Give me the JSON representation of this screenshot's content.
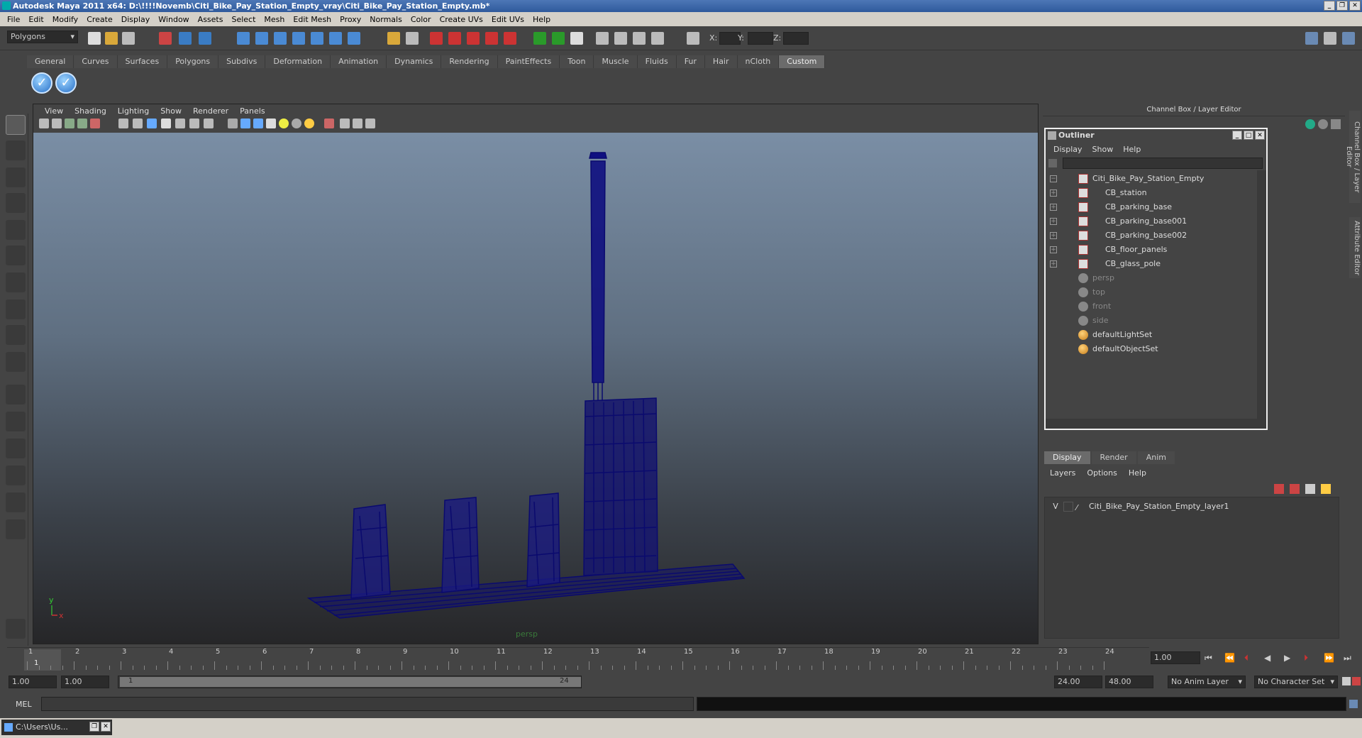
{
  "window": {
    "title": "Autodesk Maya 2011 x64: D:\\!!!!Novemb\\Citi_Bike_Pay_Station_Empty_vray\\Citi_Bike_Pay_Station_Empty.mb*"
  },
  "menubar": [
    "File",
    "Edit",
    "Modify",
    "Create",
    "Display",
    "Window",
    "Assets",
    "Select",
    "Mesh",
    "Edit Mesh",
    "Proxy",
    "Normals",
    "Color",
    "Create UVs",
    "Edit UVs",
    "Help"
  ],
  "statusline": {
    "mode": "Polygons",
    "x_label": "X:",
    "y_label": "Y:",
    "z_label": "Z:"
  },
  "shelf": {
    "tabs": [
      "General",
      "Curves",
      "Surfaces",
      "Polygons",
      "Subdivs",
      "Deformation",
      "Animation",
      "Dynamics",
      "Rendering",
      "PaintEffects",
      "Toon",
      "Muscle",
      "Fluids",
      "Fur",
      "Hair",
      "nCloth",
      "Custom"
    ],
    "active": "Custom"
  },
  "viewport": {
    "menu": [
      "View",
      "Shading",
      "Lighting",
      "Show",
      "Renderer",
      "Panels"
    ],
    "camera_label": "persp",
    "axis_y": "y",
    "axis_x": "x",
    "wire_color": "#0a0a6e"
  },
  "channel_box": {
    "title": "Channel Box / Layer Editor"
  },
  "outliner": {
    "title": "Outliner",
    "menu": [
      "Display",
      "Show",
      "Help"
    ],
    "items": [
      {
        "label": "Citi_Bike_Pay_Station_Empty",
        "type": "mesh",
        "expand": "−",
        "indent": 0
      },
      {
        "label": "CB_station",
        "type": "mesh",
        "expand": "+",
        "indent": 1
      },
      {
        "label": "CB_parking_base",
        "type": "mesh",
        "expand": "+",
        "indent": 1
      },
      {
        "label": "CB_parking_base001",
        "type": "mesh",
        "expand": "+",
        "indent": 1
      },
      {
        "label": "CB_parking_base002",
        "type": "mesh",
        "expand": "+",
        "indent": 1
      },
      {
        "label": "CB_floor_panels",
        "type": "mesh",
        "expand": "+",
        "indent": 1
      },
      {
        "label": "CB_glass_pole",
        "type": "mesh",
        "expand": "+",
        "indent": 1
      },
      {
        "label": "persp",
        "type": "camera",
        "expand": "",
        "indent": 0
      },
      {
        "label": "top",
        "type": "camera",
        "expand": "",
        "indent": 0
      },
      {
        "label": "front",
        "type": "camera",
        "expand": "",
        "indent": 0
      },
      {
        "label": "side",
        "type": "camera",
        "expand": "",
        "indent": 0
      },
      {
        "label": "defaultLightSet",
        "type": "set",
        "expand": "",
        "indent": 0
      },
      {
        "label": "defaultObjectSet",
        "type": "set",
        "expand": "",
        "indent": 0
      }
    ]
  },
  "layer_editor": {
    "tabs": [
      "Display",
      "Render",
      "Anim"
    ],
    "active_tab": "Display",
    "menu": [
      "Layers",
      "Options",
      "Help"
    ],
    "layers": [
      {
        "visible": "V",
        "name": "Citi_Bike_Pay_Station_Empty_layer1"
      }
    ]
  },
  "side_tabs": [
    "Channel Box / Layer Editor",
    "Attribute Editor"
  ],
  "time_slider": {
    "ticks": [
      "1",
      "2",
      "3",
      "4",
      "5",
      "6",
      "7",
      "8",
      "9",
      "10",
      "11",
      "12",
      "13",
      "14",
      "15",
      "16",
      "17",
      "18",
      "19",
      "20",
      "21",
      "22",
      "23",
      "24"
    ],
    "current_frame": "1.00",
    "current_marker": "1"
  },
  "range_slider": {
    "start_time": "1.00",
    "playback_start": "1.00",
    "range_start_label": "1",
    "range_end_label": "24",
    "playback_end": "24.00",
    "end_time": "48.00",
    "anim_layer": "No Anim Layer",
    "character_set": "No Character Set"
  },
  "command_line": {
    "label": "MEL"
  },
  "taskbar": {
    "item": "C:\\Users\\Us..."
  }
}
